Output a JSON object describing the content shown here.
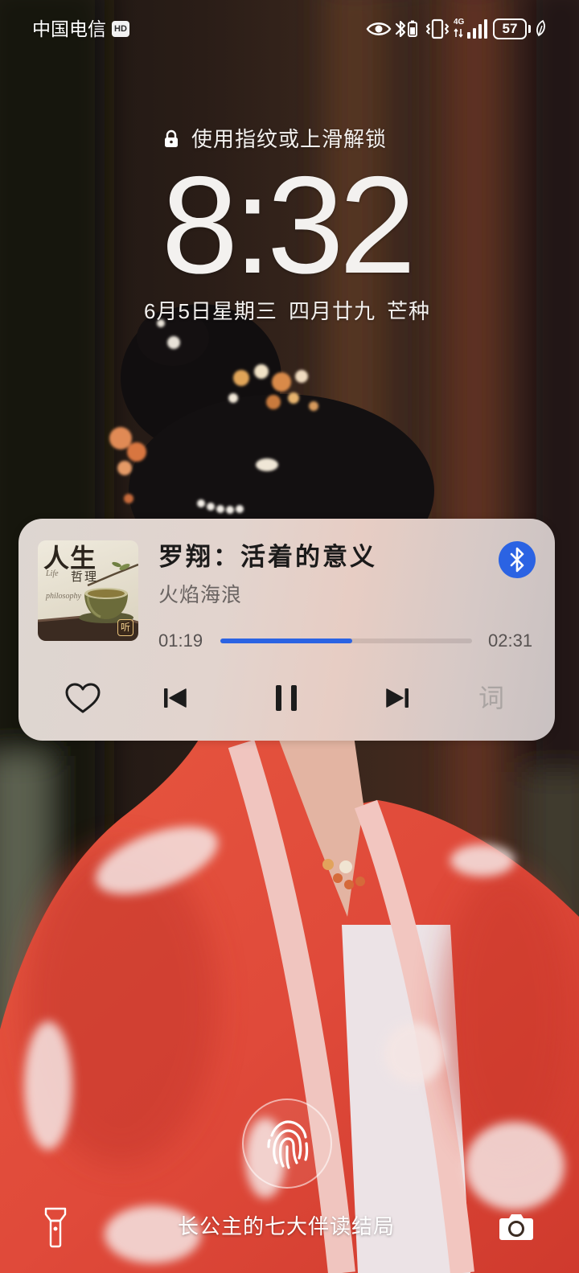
{
  "status_bar": {
    "carrier": "中国电信",
    "hd_badge": "HD",
    "network": "4G",
    "battery_level": "57",
    "icons": [
      "eye-comfort-icon",
      "bluetooth-icon",
      "vibrate-icon",
      "cellular-signal-icon",
      "battery-icon",
      "power-saving-leaf-icon"
    ]
  },
  "lock_hint": {
    "icon": "lock-icon",
    "text": "使用指纹或上滑解锁"
  },
  "clock": {
    "time": "8:32",
    "date": "6月5日星期三",
    "lunar_date": "四月廿九",
    "solar_term": "芒种"
  },
  "media_card": {
    "album_art": {
      "title_large": "人生",
      "title_small": "哲理",
      "english_line1": "Life",
      "english_line2": "philosophy",
      "badge": "听"
    },
    "title": "罗翔：活着的意义",
    "artist": "火焰海浪",
    "elapsed": "01:19",
    "duration": "02:31",
    "progress": 0.523,
    "output_device_icon": "bluetooth-icon",
    "controls": {
      "favorite_icon": "heart-outline-icon",
      "previous_icon": "skip-previous-icon",
      "play_pause_icon": "pause-icon",
      "next_icon": "skip-next-icon",
      "lyrics_label": "词"
    }
  },
  "fingerprint": {
    "icon": "fingerprint-icon"
  },
  "bottom_bar": {
    "left_icon": "flashlight-icon",
    "caption": "长公主的七大伴读结局",
    "right_icon": "camera-icon"
  },
  "colors": {
    "accent": "#2b63e3",
    "text_primary": "#1b1a1a",
    "text_secondary": "#6a6462",
    "lyrics_disabled": "#aaa4a2",
    "clock_text": "#f3f1ef"
  }
}
